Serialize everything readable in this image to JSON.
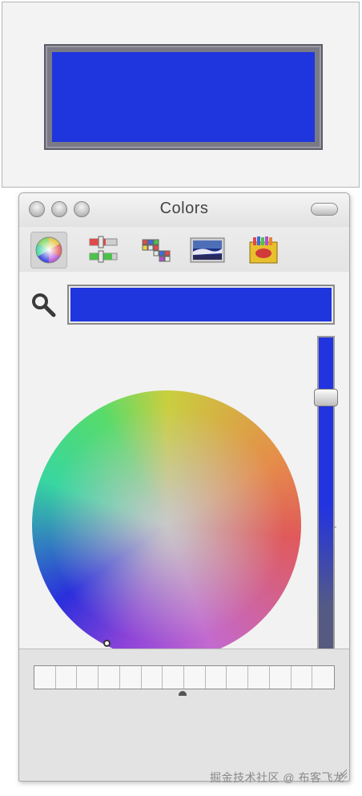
{
  "window": {
    "title": "Colors"
  },
  "toolbar": {
    "modes": [
      {
        "icon": "color-wheel-icon",
        "selected": true
      },
      {
        "icon": "color-sliders-icon",
        "selected": false
      },
      {
        "icon": "color-palettes-icon",
        "selected": false
      },
      {
        "icon": "image-palettes-icon",
        "selected": false
      },
      {
        "icon": "crayons-icon",
        "selected": false
      }
    ]
  },
  "current_color": "#1f35de",
  "brightness_fraction": 0.85,
  "swatch_count": 14,
  "watermark": "掘金技术社区 @ 布客飞龙"
}
